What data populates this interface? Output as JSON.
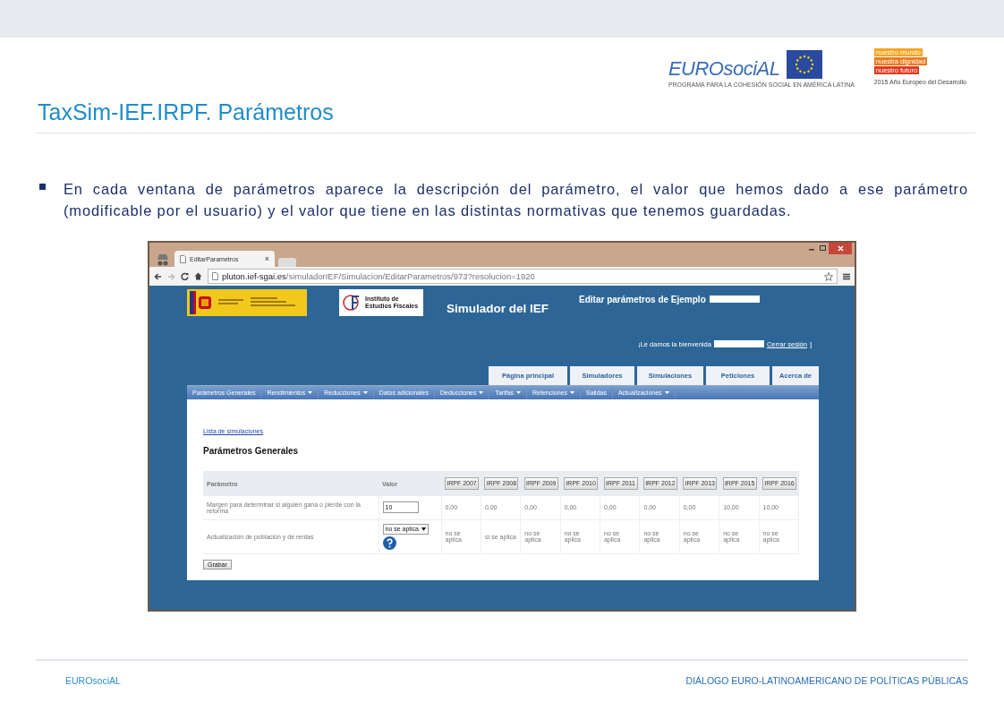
{
  "header": {
    "logo": {
      "wordmark": "EUROsociAL",
      "tagline": "PROGRAMA PARA LA COHESIÓN SOCIAL EN AMÉRICA LATINA"
    },
    "badge": {
      "lines": [
        {
          "text": "nuestro mundo",
          "color": "#f5a623"
        },
        {
          "text": "nuestra dignidad",
          "color": "#ee7a1c"
        },
        {
          "text": "nuestro futuro",
          "color": "#e03a1e"
        }
      ],
      "caption": "2015 Año Europeo del Desarrollo"
    }
  },
  "title": "TaxSim-IEF.IRPF. Parámetros",
  "bullet": "En cada ventana de parámetros aparece la descripción del parámetro, el valor que hemos dado a ese parámetro (modificable por el usuario) y el valor que tiene en las distintas normativas que tenemos guardadas.",
  "browser": {
    "tab": {
      "title": "EditarParametros",
      "close": "×"
    },
    "url_host": "pluton.ief-sgai.es",
    "url_path": "/simuladorIEF/Simulacion/EditarParametros/973?resolucion=1920",
    "page": {
      "ief_logo": "Instituto de Estudios Fiscales",
      "site_title": "Simulador del IEF",
      "edit_title": "Editar parámetros de Ejemplo",
      "welcome": "¡Le damos la bienvenida",
      "logout": "Cerrar sesión",
      "bracket": "]",
      "main_tabs": [
        "Página principal",
        "Simuladores",
        "Simulaciones",
        "Peticiones",
        "Acerca de"
      ],
      "menu": [
        {
          "label": "Parámetros Generales",
          "dropdown": false
        },
        {
          "label": "Rendimientos",
          "dropdown": true
        },
        {
          "label": "Reducciones",
          "dropdown": true
        },
        {
          "label": "Datos adicionales",
          "dropdown": false
        },
        {
          "label": "Deducciones",
          "dropdown": true
        },
        {
          "label": "Tarifas",
          "dropdown": true
        },
        {
          "label": "Retenciones",
          "dropdown": true
        },
        {
          "label": "Salidas",
          "dropdown": false
        },
        {
          "label": "Actualizaciones",
          "dropdown": true
        }
      ],
      "back_link": "Lista de simulaciones",
      "heading": "Parámetros Generales",
      "table": {
        "columns": [
          "Parámetro",
          "Valor"
        ],
        "years": [
          "IRPF 2007",
          "IRPF 2008",
          "IRPF 2009",
          "IRPF 2010",
          "IRPF 2011",
          "IRPF 2012",
          "IRPF 2013",
          "IRPF 2015",
          "IRPF 2016"
        ],
        "rows": [
          {
            "kind": "input",
            "name": "Margen para determinar si alguien gana o pierde con la reforma",
            "value": "10",
            "cells": [
              "0,00",
              "0,00",
              "0,00",
              "0,00",
              "0,00",
              "0,00",
              "0,00",
              "10,00",
              "10,00"
            ]
          },
          {
            "kind": "select",
            "name": "Actualización de población y de rentas",
            "value": "no se aplica",
            "cells": [
              "no se aplica",
              "sí se aplica",
              "no se aplica",
              "no se aplica",
              "no se aplica",
              "no se aplica",
              "no se aplica",
              "no se aplica",
              "no se aplica"
            ]
          }
        ]
      },
      "save": "Grabar"
    }
  },
  "footer": {
    "left": "EUROsociAL",
    "right": "DIÁLOGO EURO-LATINOAMERICANO DE POLÍTICAS PÚBLICAS"
  }
}
